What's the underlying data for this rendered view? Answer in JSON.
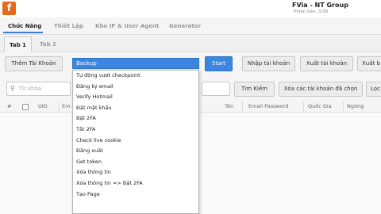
{
  "app": {
    "logo_letter": "f",
    "title": "FVia - NT Group",
    "version": "Phiên bản: 3.08"
  },
  "main_tabs": [
    {
      "label": "Chức Năng",
      "active": true
    },
    {
      "label": "Thiết Lập",
      "active": false
    },
    {
      "label": "Kho IP & User Agent",
      "active": false
    },
    {
      "label": "Generator",
      "active": false
    }
  ],
  "sub_tabs": [
    {
      "label": "Tab 1",
      "active": true
    },
    {
      "label": "Tab 2",
      "active": false
    }
  ],
  "toolbar": {
    "add_account": "Thêm Tài Khoản",
    "action_selected": "Backup",
    "start": "Start",
    "import_accounts": "Nhập tài khoản",
    "export_accounts": "Xuất tài khoản",
    "export_truncated": "Xuất b"
  },
  "search": {
    "placeholder": "Từ khóa",
    "search_button": "Tìm Kiếm",
    "delete_selected": "Xóa các tài khoản đã chọn",
    "filter_truncated": "Lọc"
  },
  "table": {
    "columns": [
      "#",
      "UID",
      "Em",
      "Tên",
      "Email Password",
      "Quốc Gia",
      "Ngừng"
    ]
  },
  "dropdown": {
    "options": [
      "Backup",
      "Tự động vượt checkpoint",
      "Đăng ký email",
      "Verify Hotmail",
      "Đặt mật khẩu",
      "Bật 2FA",
      "Tắt 2FA",
      "Check live cookie",
      "Đăng xuất",
      "Get token",
      "Xóa thông tin",
      "Xóa thông tin => Bật 2FA",
      "Tạo Page"
    ]
  },
  "colors": {
    "accent": "#3a86e0",
    "logo": "#e8691a"
  }
}
